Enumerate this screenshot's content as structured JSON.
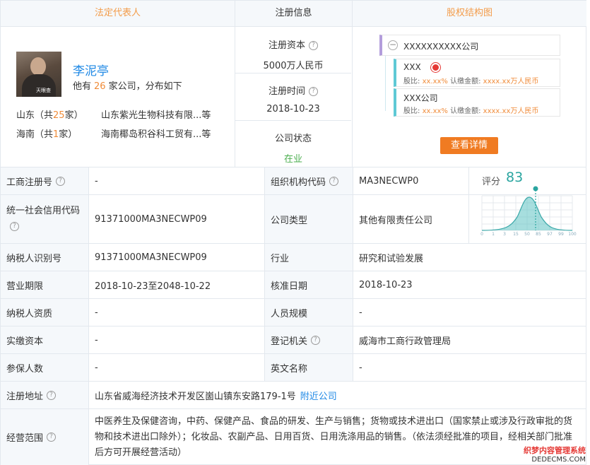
{
  "columns": {
    "legal_rep": "法定代表人",
    "reg_info": "注册信息",
    "equity": "股权结构图"
  },
  "person": {
    "name": "李泥亭",
    "avatar_watermark": "天眼查",
    "info_prefix": "他有",
    "company_count": "26",
    "info_suffix": "家公司，分布如下",
    "regions": [
      {
        "prefix": "山东（共",
        "count": "25",
        "suffix": "家）",
        "company": "山东紫光生物科技有限...等"
      },
      {
        "prefix": "海南（共",
        "count": "1",
        "suffix": "家）",
        "company": "海南椰岛积谷科工贸有...等"
      }
    ]
  },
  "registration": {
    "capital_label": "注册资本",
    "capital_value": "5000万人民币",
    "time_label": "注册时间",
    "time_value": "2018-10-23",
    "status_label": "公司状态",
    "status_value": "在业"
  },
  "equity": {
    "root": "XXXXXXXXXX公司",
    "nodes": [
      {
        "name": "XXX",
        "ratio_label": "股比:",
        "ratio": "xx.xx%",
        "amount_label": "认缴金额:",
        "amount": "xxxx.xx万人民币"
      },
      {
        "name": "XXX公司",
        "ratio_label": "股比:",
        "ratio": "xx.xx%",
        "amount_label": "认缴金额:",
        "amount": "xxxx.xx万人民币"
      }
    ],
    "detail_button": "查看详情"
  },
  "score": {
    "label": "评分",
    "value": "83",
    "ticks": [
      "0",
      "1",
      "3",
      "15",
      "50",
      "85",
      "97",
      "99",
      "100"
    ]
  },
  "table": {
    "rows": [
      {
        "l1": "工商注册号",
        "v1": "-",
        "l2": "组织机构代码",
        "v2": "MA3NECWP0"
      },
      {
        "l1": "统一社会信用代码",
        "v1": "91371000MA3NECWP09",
        "l2": "公司类型",
        "v2": "其他有限责任公司"
      },
      {
        "l1": "纳税人识别号",
        "v1": "91371000MA3NECWP09",
        "l2": "行业",
        "v2": "研究和试验发展"
      },
      {
        "l1": "营业期限",
        "v1": "2018-10-23至2048-10-22",
        "l2": "核准日期",
        "v2": "2018-10-23"
      },
      {
        "l1": "纳税人资质",
        "v1": "-",
        "l2": "人员规模",
        "v2": "-"
      },
      {
        "l1": "实缴资本",
        "v1": "-",
        "l2": "登记机关",
        "v2": "威海市工商行政管理局"
      },
      {
        "l1": "参保人数",
        "v1": "-",
        "l2": "英文名称",
        "v2": "-"
      }
    ],
    "address_label": "注册地址",
    "address_value": "山东省威海经济技术开发区崮山镇东安路179-1号",
    "address_link": "附近公司",
    "scope_label": "经营范围",
    "scope_value": "中医养生及保健咨询，中药、保健产品、食品的研发、生产与销售；货物或技术进出口（国家禁止或涉及行政审批的货物和技术进出口除外）；化妆品、农副产品、日用百货、日用洗涤用品的销售。（依法须经批准的项目，经相关部门批准后方可开展经营活动）"
  },
  "watermark": {
    "line1": "织梦内容管理系统",
    "line2": "DEDECMS.COM"
  }
}
